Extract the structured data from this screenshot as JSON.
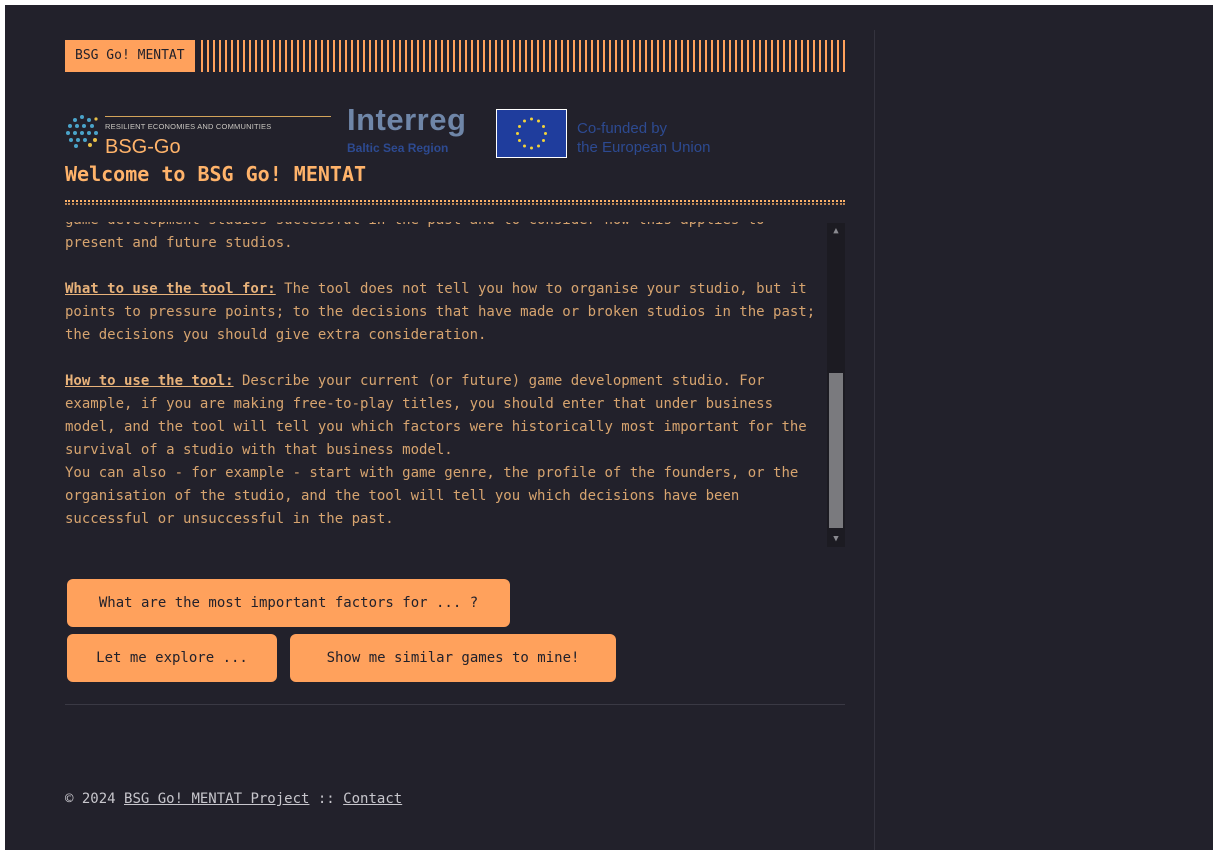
{
  "header": {
    "title_tag": "BSG Go! MENTAT"
  },
  "logos": {
    "bsg_tagline": "RESILIENT ECONOMIES AND COMMUNITIES",
    "bsg_name": "BSG-Go",
    "interreg_name": "Interreg",
    "interreg_region": "Baltic Sea Region",
    "eu_line1": "Co-funded by",
    "eu_line2": "the European Union"
  },
  "main": {
    "welcome_title": "Welcome to BSG Go! MENTAT",
    "intro_partial": "game development studios successful in the past and to consider how this applies to present and future studios.",
    "what_heading": "What to use the tool for:",
    "what_text": " The tool does not tell you how to organise your studio, but it points to pressure points; to the decisions that have made or broken studios in the past; the decisions you should give extra consideration.",
    "how_heading": "How to use the tool:",
    "how_text": " Describe your current (or future) game development studio. For example, if you are making free-to-play titles, you should enter that under business model, and the tool will tell you which factors were historically most important for the survival of a studio with that business model.",
    "also_text": "You can also - for example - start with game genre, the profile of the founders, or the organisation of the studio, and the tool will tell you which decisions have been successful or unsuccessful in the past."
  },
  "buttons": {
    "important_factors": "What are the most important factors for ... ?",
    "explore": "Let me explore ...",
    "similar_games": "Show me similar games to mine!"
  },
  "footer": {
    "copyright": "© 2024 ",
    "project_link": "BSG Go! MENTAT Project",
    "separator": " :: ",
    "contact_link": "Contact"
  },
  "colors": {
    "background": "#22212b",
    "accent": "#ffa15c",
    "text": "#d7a46f"
  }
}
